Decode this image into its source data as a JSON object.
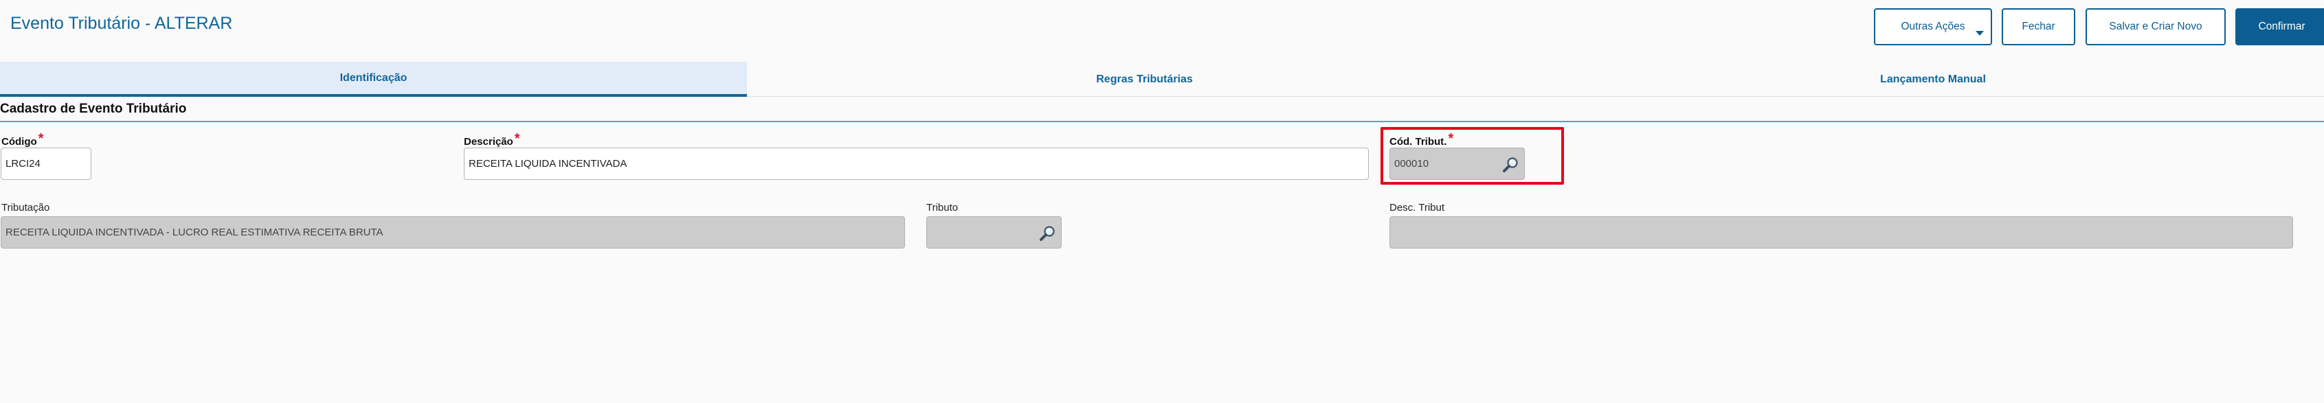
{
  "header": {
    "title": "Evento Tributário - ALTERAR",
    "buttons": {
      "outras_acoes": "Outras Ações",
      "fechar": "Fechar",
      "salvar_criar_novo": "Salvar e Criar Novo",
      "confirmar": "Confirmar"
    }
  },
  "tabs": [
    {
      "label": "Identificação",
      "active": true
    },
    {
      "label": "Regras Tributárias",
      "active": false
    },
    {
      "label": "Lançamento Manual",
      "active": false
    }
  ],
  "section": {
    "title": "Cadastro de Evento Tributário"
  },
  "form": {
    "codigo": {
      "label": "Código",
      "required_mark": "*",
      "value": "LRCI24"
    },
    "descricao": {
      "label": "Descrição",
      "required_mark": "*",
      "value": "RECEITA LIQUIDA INCENTIVADA"
    },
    "cod_tribut": {
      "label": "Cód. Tribut.",
      "required_mark": "*",
      "value": "000010"
    },
    "tributacao": {
      "label": "Tributação",
      "value": "RECEITA LIQUIDA INCENTIVADA - LUCRO REAL ESTIMATIVA RECEITA BRUTA"
    },
    "tributo": {
      "label": "Tributo",
      "value": ""
    },
    "desc_tribut": {
      "label": "Desc. Tribut",
      "value": ""
    }
  },
  "icons": {
    "lookup": "search-magnifier-icon",
    "dropdown": "caret-down-icon"
  },
  "colors": {
    "primary": "#0c5e92",
    "title": "#11669a",
    "active_tab_bg": "#e2ecf8",
    "required": "#e3132b",
    "highlight": "#e3081a",
    "disabled_field": "#cccccc"
  }
}
